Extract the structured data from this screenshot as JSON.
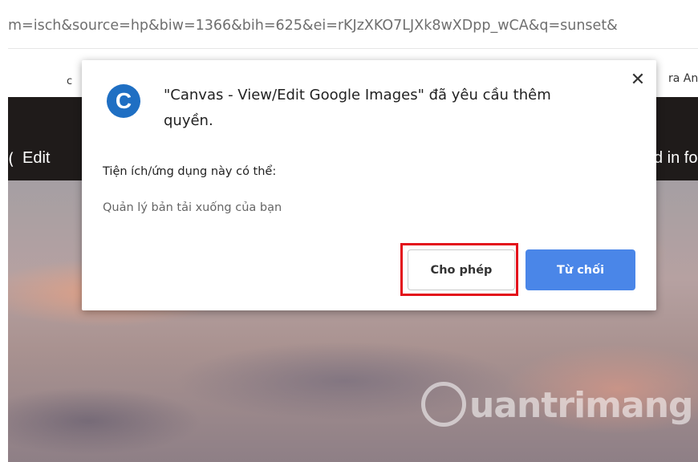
{
  "browser": {
    "url": "m=isch&source=hp&biw=1366&bih=625&ei=rKJzXKO7LJXk8wXDpp_wCA&q=sunset&",
    "bookmark_left": "c",
    "bookmark_right": "ra And..."
  },
  "toolbar": {
    "left_mark": "(",
    "edit_label": "Edit",
    "right_label": "d in fo"
  },
  "dialog": {
    "icon_letter": "C",
    "title": "\"Canvas - View/Edit Google Images\" đã yêu cầu thêm quyền.",
    "close_glyph": "✕",
    "permissions_heading": "Tiện ích/ứng dụng này có thể:",
    "permission_item": "Quản lý bản tải xuống của bạn",
    "allow_label": "Cho phép",
    "deny_label": "Từ chối",
    "colors": {
      "deny_bg": "#4a86e8",
      "highlight": "#e3101b",
      "icon_bg": "#1f6fc3"
    }
  },
  "watermark": {
    "text": "uantrimang",
    "icon": "lightbulb-logo-icon"
  }
}
